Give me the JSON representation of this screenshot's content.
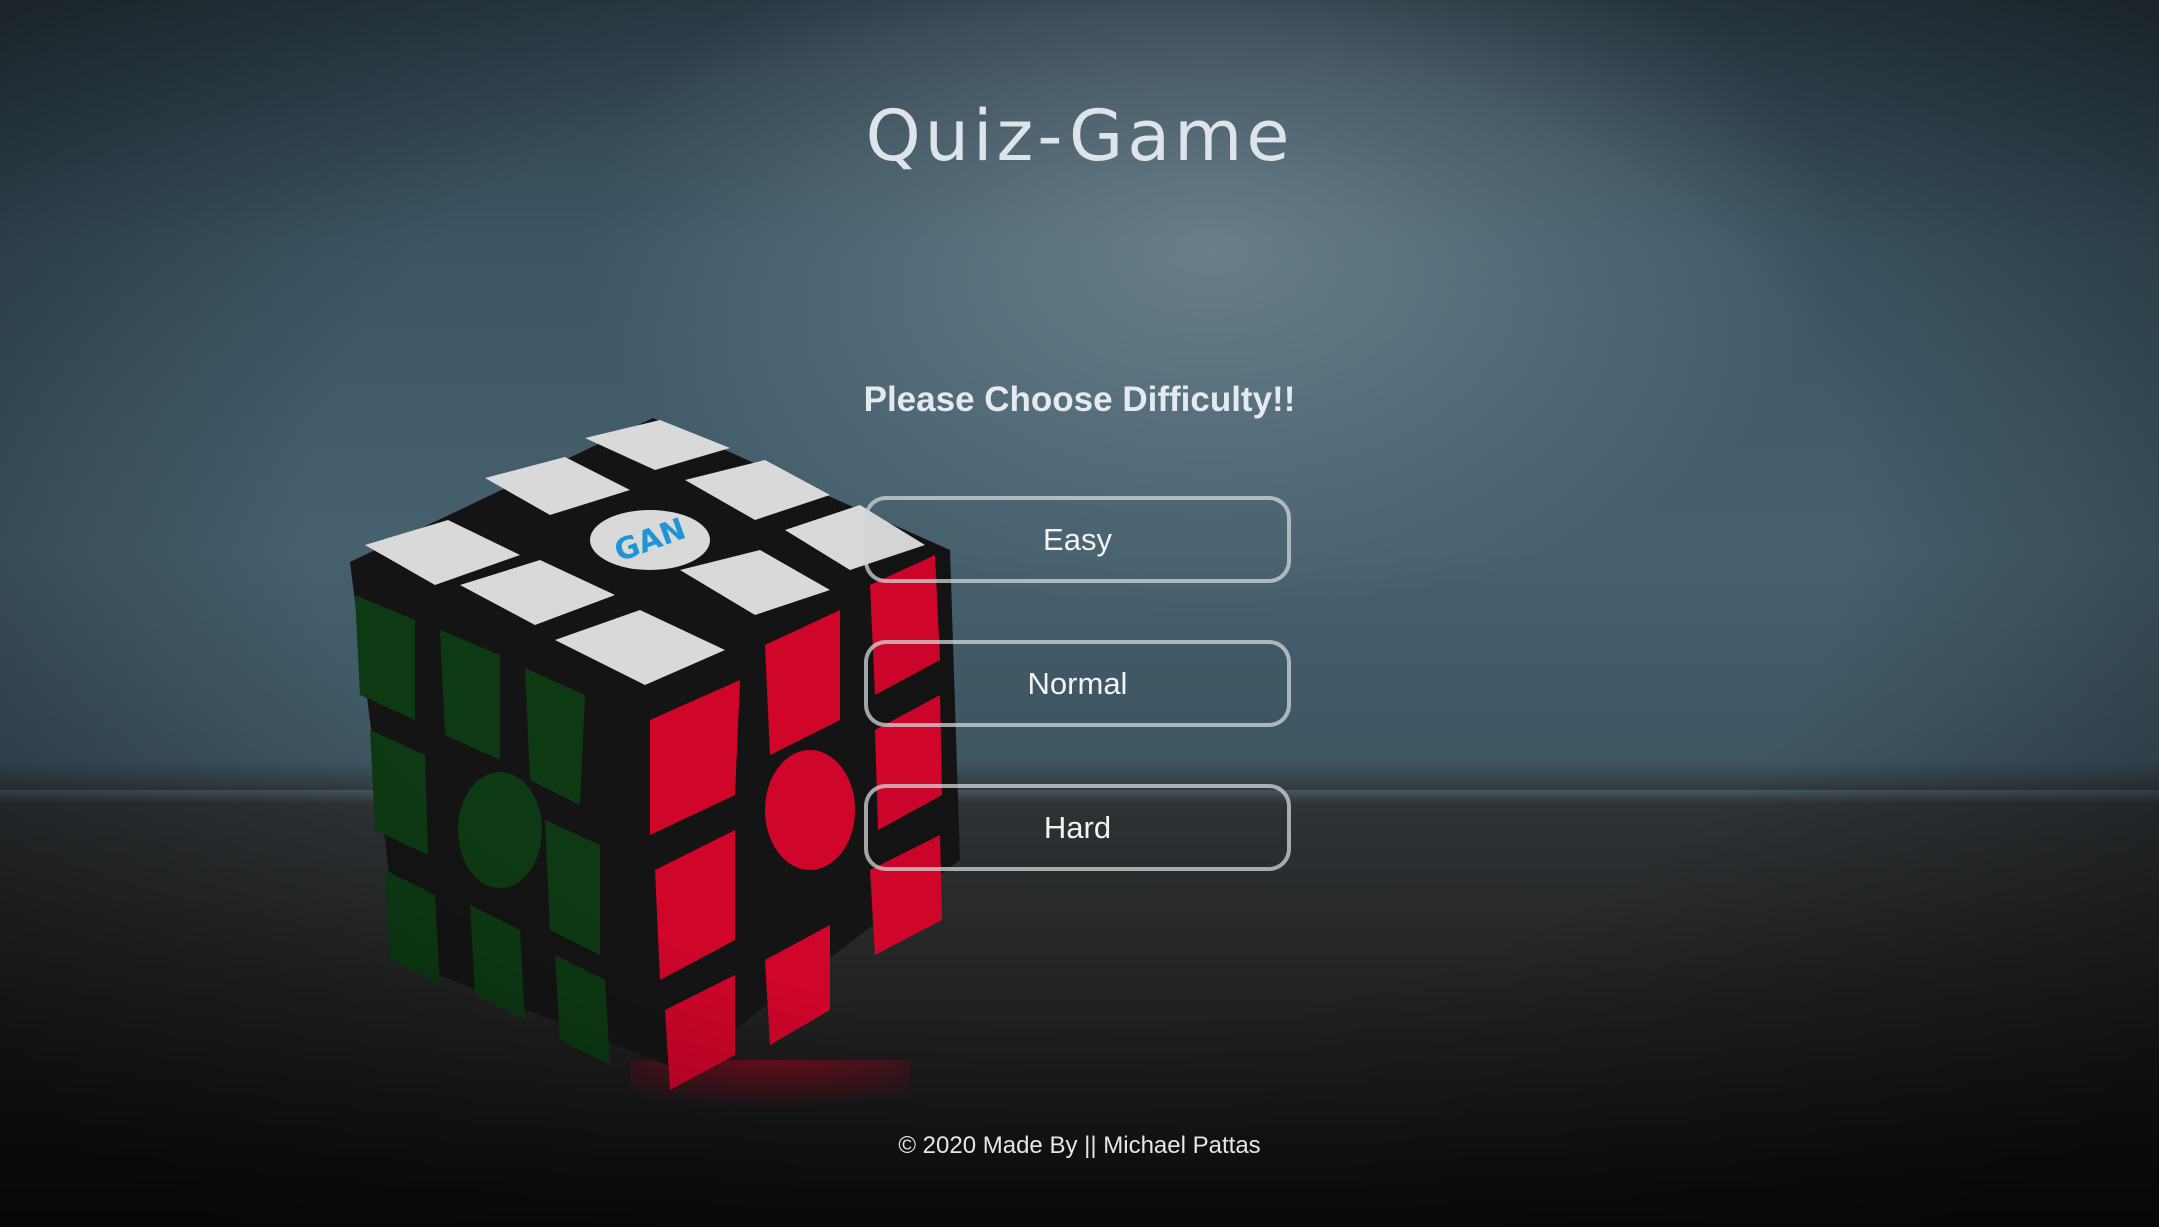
{
  "header": {
    "title": "Quiz-Game"
  },
  "main": {
    "prompt": "Please Choose Difficulty!!",
    "difficulties": [
      {
        "label": "Easy"
      },
      {
        "label": "Normal"
      },
      {
        "label": "Hard"
      }
    ]
  },
  "footer": {
    "text": "© 2020 Made By || Michael Pattas"
  },
  "background": {
    "icon": "rubiks-cube-photo",
    "logo_text": "GAN",
    "colors": {
      "sticker_white": "#d9d9d9",
      "sticker_red": "#d0052a",
      "sticker_green": "#0d3a12",
      "cube_body": "#141414",
      "logo_blue": "#1f95d6"
    }
  }
}
